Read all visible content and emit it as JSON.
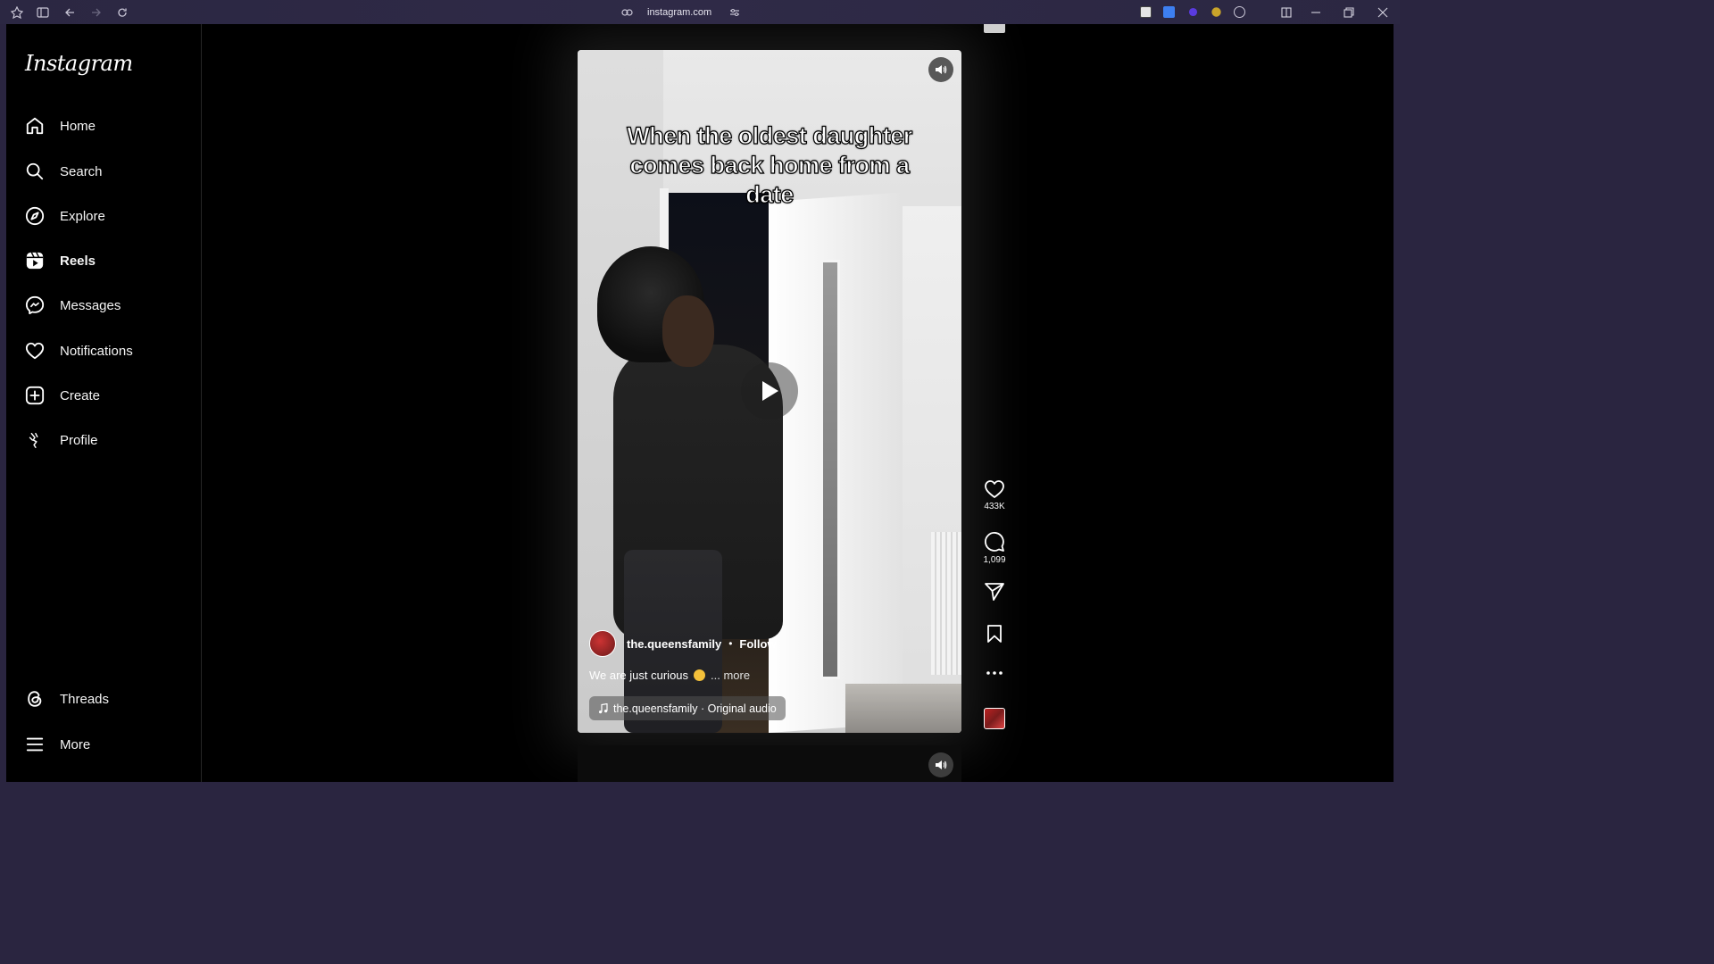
{
  "browser": {
    "url": "instagram.com"
  },
  "sidebar": {
    "logo": "Instagram",
    "items": [
      {
        "label": "Home",
        "icon": "home-icon"
      },
      {
        "label": "Search",
        "icon": "search-icon"
      },
      {
        "label": "Explore",
        "icon": "compass-icon"
      },
      {
        "label": "Reels",
        "icon": "reels-icon",
        "active": true
      },
      {
        "label": "Messages",
        "icon": "messenger-icon"
      },
      {
        "label": "Notifications",
        "icon": "heart-icon"
      },
      {
        "label": "Create",
        "icon": "plus-square-icon"
      },
      {
        "label": "Profile",
        "icon": "profile-icon"
      }
    ],
    "bottom": [
      {
        "label": "Threads",
        "icon": "threads-icon"
      },
      {
        "label": "More",
        "icon": "menu-icon"
      }
    ]
  },
  "reel": {
    "overlay_text": "When the oldest daughter comes back home from a date",
    "username": "the.queensfamily",
    "separator": "•",
    "follow_label": "Follow",
    "caption": "We are just curious",
    "more_label": "... more",
    "audio": "the.queensfamily · Original audio"
  },
  "actions": {
    "likes": "433K",
    "comments": "1,099"
  },
  "colors": {
    "background": "#000000",
    "browser_bar": "#2b2742",
    "text": "#f5f5f5"
  }
}
